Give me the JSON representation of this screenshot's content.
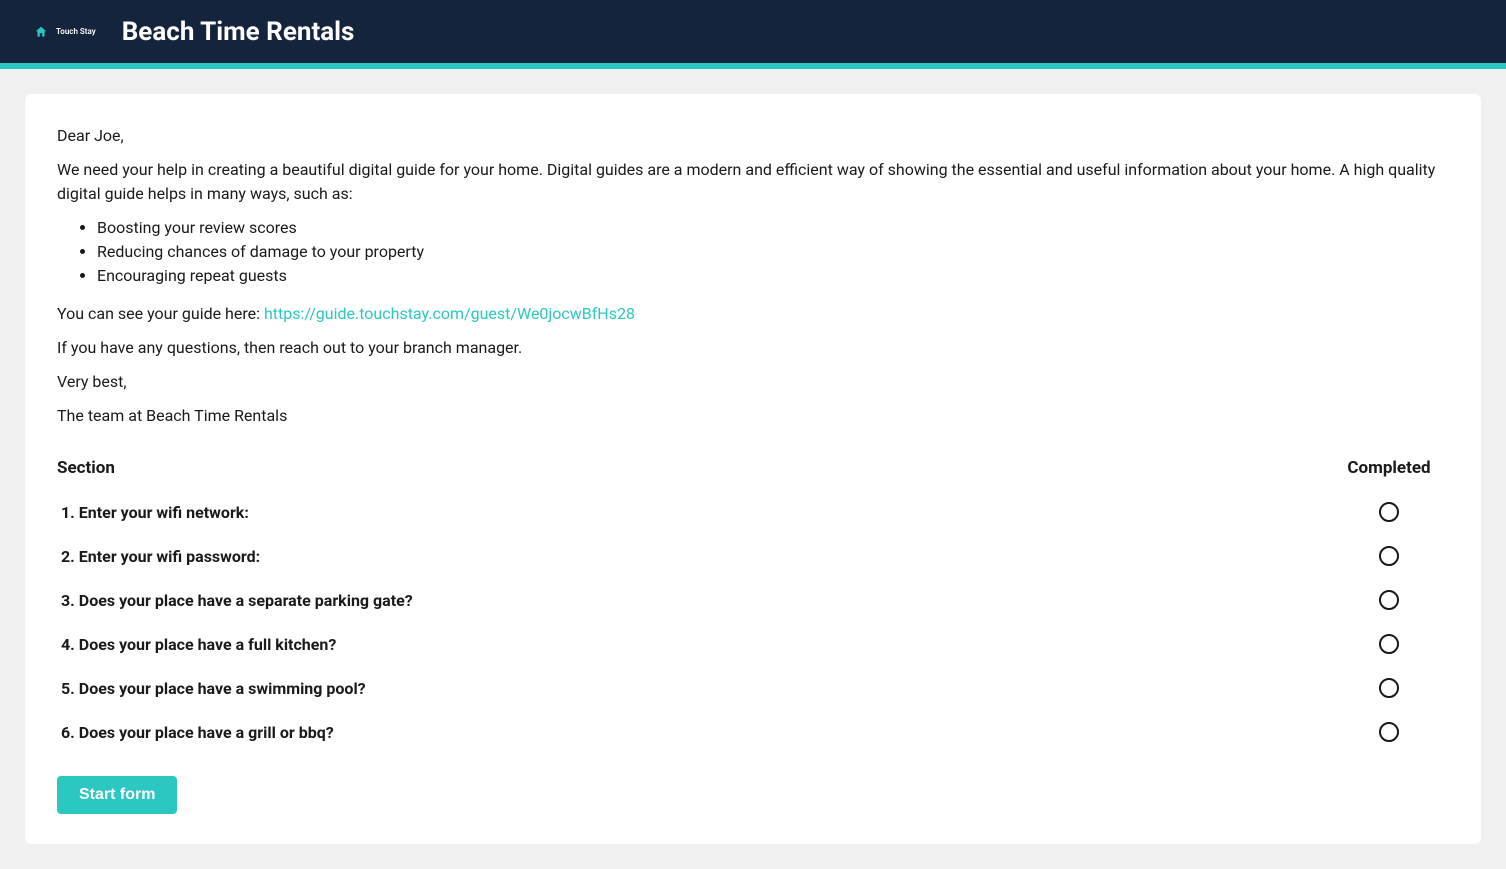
{
  "header": {
    "logo_text": "Touch Stay",
    "site_title": "Beach Time Rentals"
  },
  "intro": {
    "greeting": "Dear Joe,",
    "lead": "We need your help in creating a beautiful digital guide for your home. Digital guides are a modern and efficient way of showing the essential and useful information about your home. A high quality digital guide helps in many ways, such as:",
    "bullets": [
      "Boosting your review scores",
      "Reducing chances of damage to your property",
      "Encouraging repeat guests"
    ],
    "guide_prefix": "You can see your guide here: ",
    "guide_link": "https://guide.touchstay.com/guest/We0jocwBfHs28",
    "questions_line": "If you have any questions, then reach out to your branch manager.",
    "closing": "Very best,",
    "signature": "The team at Beach Time Rentals"
  },
  "table": {
    "section_header": "Section",
    "completed_header": "Completed",
    "rows": [
      "1. Enter your wifi network:",
      "2. Enter your wifi password:",
      "3. Does your place have a separate parking gate?",
      "4. Does your place have a full kitchen?",
      "5. Does your place have a swimming pool?",
      "6. Does your place have a grill or bbq?"
    ]
  },
  "actions": {
    "start_form_label": "Start form"
  }
}
